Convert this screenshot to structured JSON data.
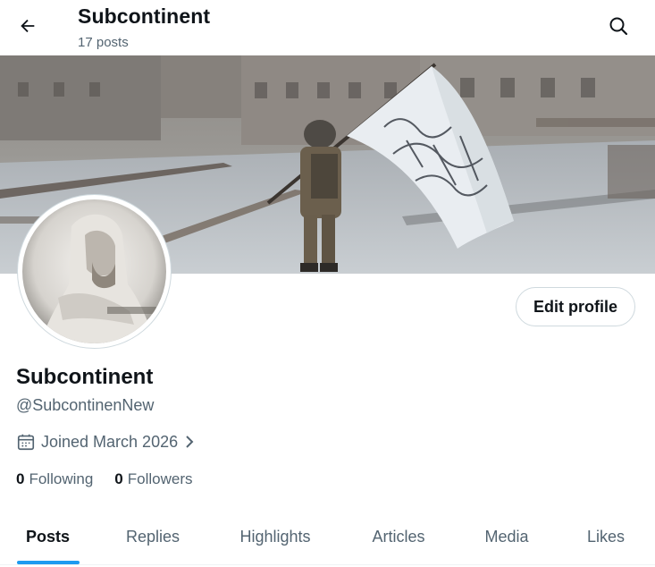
{
  "header": {
    "title": "Subcontinent",
    "post_count": "17 posts",
    "back_icon": "arrow-left-icon",
    "search_icon": "search-icon"
  },
  "banner": {
    "description_icon": "banner-image"
  },
  "profile": {
    "display_name": "Subcontinent",
    "handle": "@SubcontinenNew",
    "joined": "Joined March 2026",
    "edit_label": "Edit profile",
    "following_count": "0",
    "following_label": "Following",
    "followers_count": "0",
    "followers_label": "Followers"
  },
  "tabs": [
    {
      "label": "Posts",
      "active": true
    },
    {
      "label": "Replies",
      "active": false
    },
    {
      "label": "Highlights",
      "active": false
    },
    {
      "label": "Articles",
      "active": false
    },
    {
      "label": "Media",
      "active": false
    },
    {
      "label": "Likes",
      "active": false
    }
  ],
  "colors": {
    "accent": "#1d9bf0",
    "text": "#0f1419",
    "secondary": "#536471",
    "border": "#cfd9de"
  }
}
